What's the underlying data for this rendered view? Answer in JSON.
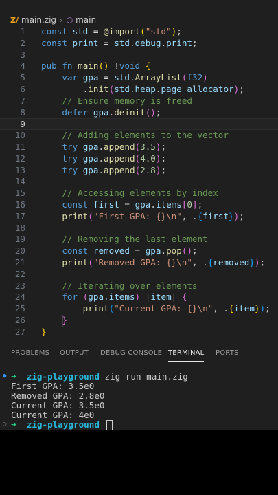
{
  "breadcrumb": {
    "file_icon": "zig-file-icon",
    "file": "main.zig",
    "separator": "›",
    "symbol_icon": "cube-symbol-icon",
    "symbol": "main"
  },
  "editor": {
    "current_line": 9
  },
  "panel": {
    "tabs": [
      "PROBLEMS",
      "OUTPUT",
      "DEBUG CONSOLE",
      "TERMINAL",
      "PORTS"
    ],
    "active_tab": "TERMINAL"
  },
  "terminal": {
    "prompt_arrow": "➜",
    "prompt_dir": "zig-playground",
    "command": "zig run main.zig",
    "output": [
      "First GPA: 3.5e0",
      "Removed GPA: 2.8e0",
      "Current GPA: 3.5e0",
      "Current GPA: 4e0"
    ]
  },
  "colors": {
    "editor_bg": "#1f1f1f",
    "keyword": "#569cd6",
    "string": "#ce9178",
    "comment": "#6a9955",
    "prompt_green": "#23d18b",
    "prompt_cyan": "#29b8db"
  }
}
